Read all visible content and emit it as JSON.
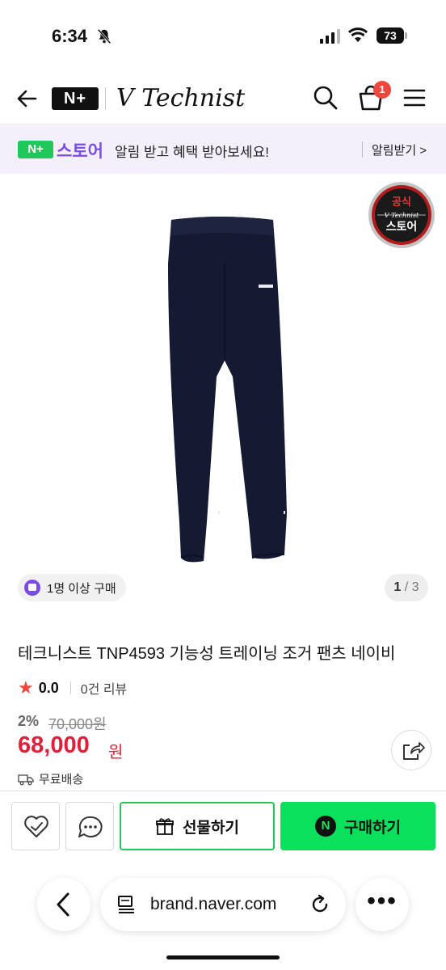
{
  "status_bar": {
    "time": "6:34",
    "battery": "73"
  },
  "header": {
    "store_badge": "N+",
    "brand": "V Technist",
    "cart_count": "1"
  },
  "promo": {
    "badge": "N+",
    "store_label": "스토어",
    "text": "알림 받고 혜택 받아보세요!",
    "link": "알림받기 >"
  },
  "gallery": {
    "official_badge_top": "공식",
    "official_badge_brand": "V Technist",
    "official_badge_bottom": "스토어",
    "min_purchase": "1명 이상 구매",
    "page_current": "1",
    "page_total": "/ 3"
  },
  "product": {
    "title": "테크니스트 TNP4593 기능성 트레이닝 조거 팬츠 네이비",
    "rating": "0.0",
    "reviews": "0건 리뷰",
    "discount": "2%",
    "original_price": "70,000원",
    "price": "68,000",
    "price_unit": "원",
    "shipping": "무료배송"
  },
  "buy_bar": {
    "gift_label": "선물하기",
    "buy_label": "구매하기",
    "buy_icon_letter": "N"
  },
  "browser": {
    "url": "brand.naver.com"
  },
  "colors": {
    "accent_green": "#0ae05b",
    "price_red": "#e0203a",
    "store_purple": "#7b4be8"
  }
}
